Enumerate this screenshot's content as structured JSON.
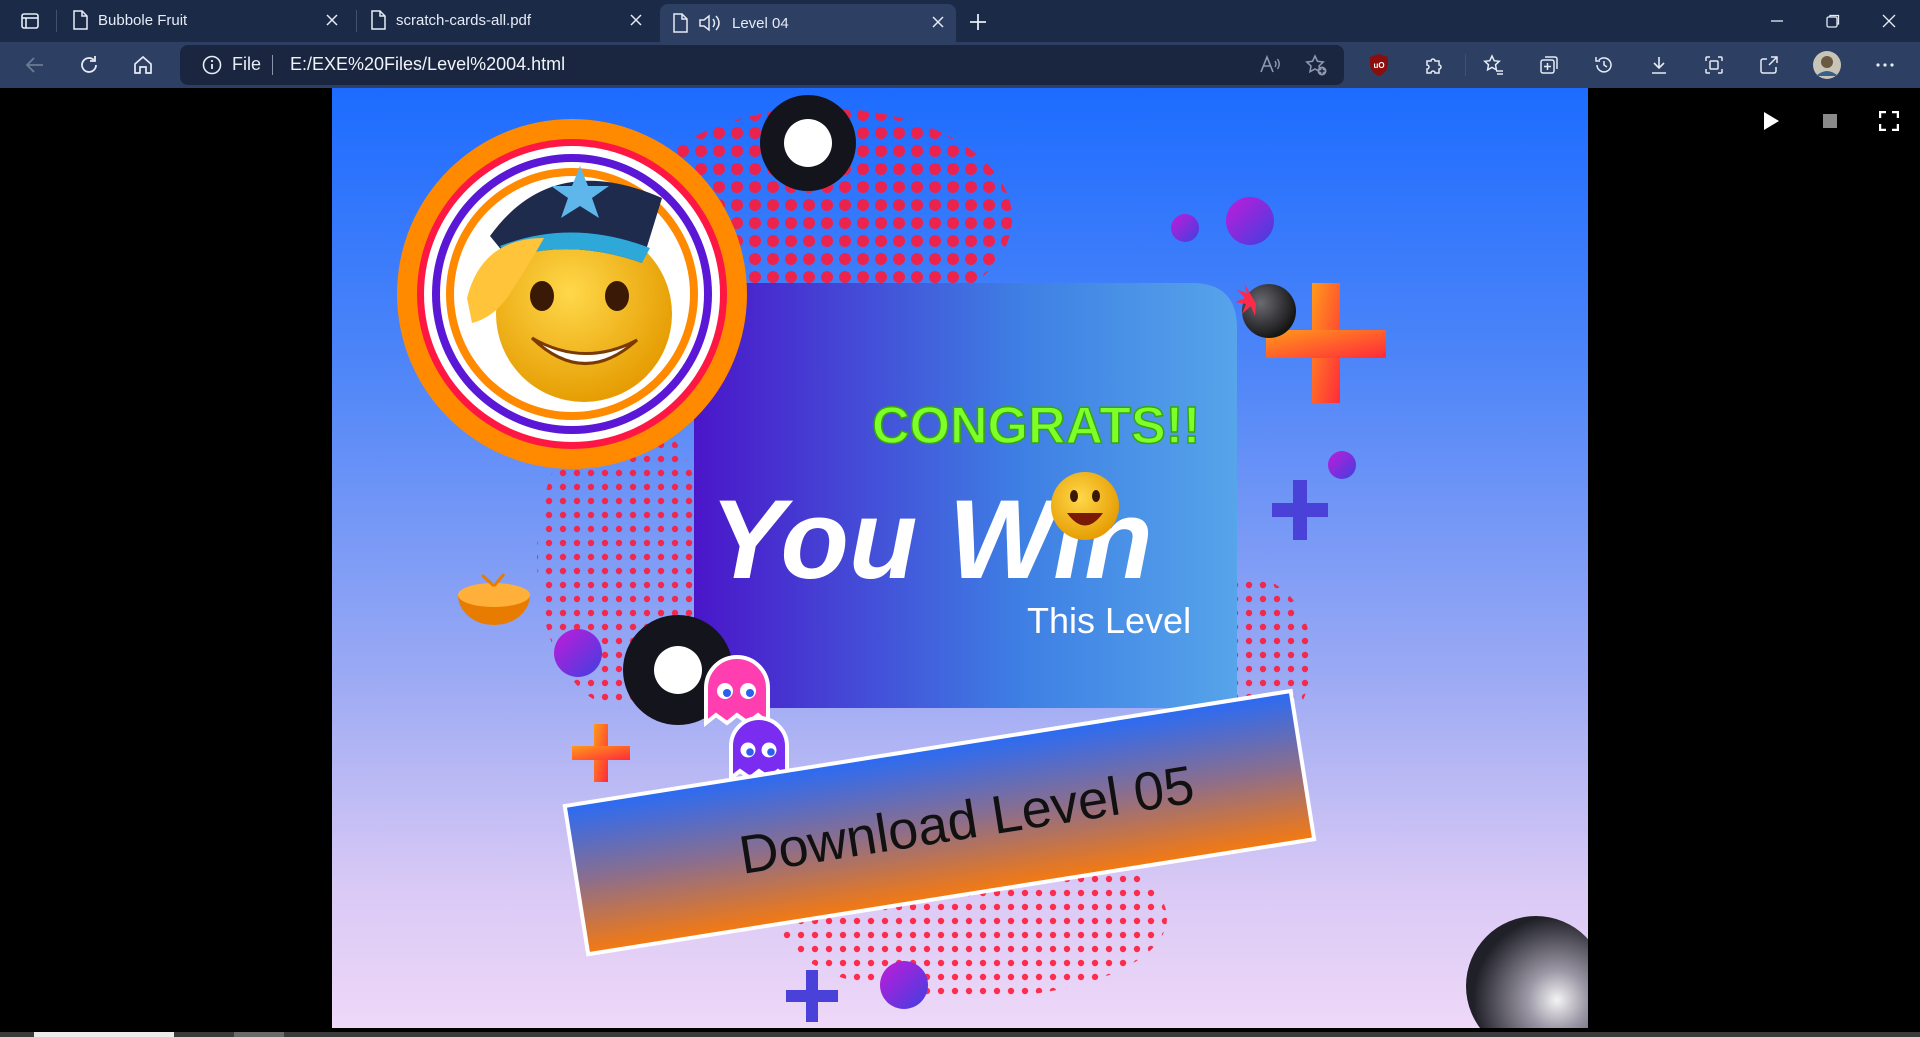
{
  "tabs": [
    {
      "label": "Bubbole Fruit",
      "icon": "document-icon"
    },
    {
      "label": "scratch-cards-all.pdf",
      "icon": "document-icon"
    },
    {
      "label": "Level 04",
      "icon": "document-icon",
      "audio_icon": "speaker-icon",
      "active": true
    }
  ],
  "address": {
    "scheme_label": "File",
    "url": "E:/EXE%20Files/Level%2004.html"
  },
  "game": {
    "congrats": "CONGRATS!!",
    "you_win": "You Win",
    "this_level": "This Level",
    "download_button": "Download Level 05"
  },
  "colors": {
    "titlebar": "#1b2a47",
    "toolbar": "#2d3f63",
    "congrats": "#7dff2a",
    "accent_orange": "#ff7a1a",
    "dots_red": "#ff1a3a"
  },
  "player_controls": [
    "play-icon",
    "stop-icon",
    "fullscreen-icon"
  ]
}
